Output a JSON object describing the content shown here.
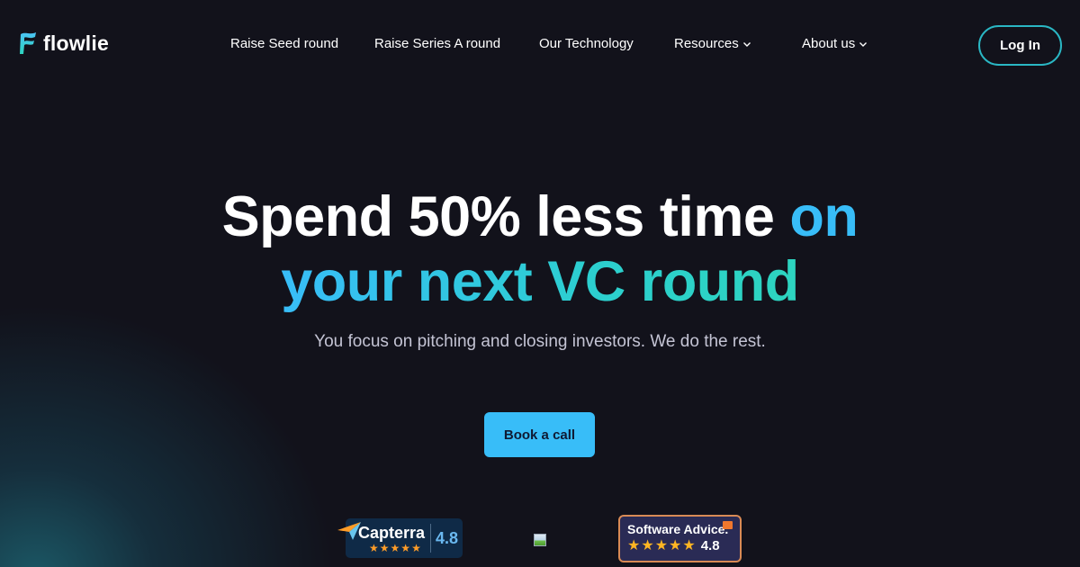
{
  "brand": {
    "name": "flowlie",
    "accent": "#38bdf8",
    "accent_teal": "#2dd4bf",
    "background": "#12121b"
  },
  "nav": {
    "links": [
      {
        "label": "Raise Seed round",
        "has_dropdown": false
      },
      {
        "label": "Raise Series A round",
        "has_dropdown": false
      },
      {
        "label": "Our Technology",
        "has_dropdown": false
      },
      {
        "label": "Resources",
        "has_dropdown": true,
        "icon": "chevron-down-icon"
      },
      {
        "label": "About us",
        "has_dropdown": true,
        "icon": "chevron-down-icon"
      }
    ],
    "login_label": "Log In"
  },
  "hero": {
    "title_white": "Spend 50% less time ",
    "title_blue": "on",
    "title_gradient": "your next VC round",
    "subtitle": "You focus on pitching and closing investors. We do the rest.",
    "cta_label": "Book a call"
  },
  "badges": {
    "capterra": {
      "name": "Capterra",
      "score": "4.8",
      "stars": 5
    },
    "broken_image": {
      "icon": "broken-image-icon"
    },
    "software_advice": {
      "name": "Software Advice.",
      "score": "4.8",
      "stars": 5
    }
  }
}
